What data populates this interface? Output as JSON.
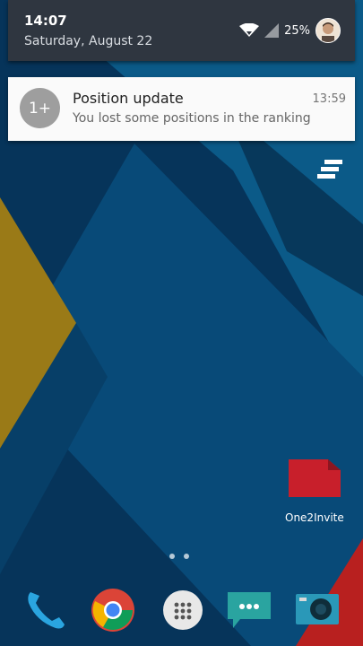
{
  "status_bar": {
    "time": "14:07",
    "date": "Saturday, August 22",
    "battery": "25%"
  },
  "notification": {
    "icon_text": "1+",
    "title": "Position update",
    "text": "You lost some positions in the ranking",
    "time": "13:59"
  },
  "home": {
    "app_label": "One2Invite",
    "page_count": 2
  },
  "dock": [
    "phone-icon",
    "chrome-icon",
    "app-drawer-icon",
    "messages-icon",
    "camera-icon"
  ],
  "colors": {
    "wallpaper_dark": "#06345a",
    "wallpaper_mid": "#0b5a88",
    "yellow": "#b58f1a",
    "red": "#b8201f",
    "notification_bg": "#fafafa",
    "shade_bg": "#2f3640"
  }
}
